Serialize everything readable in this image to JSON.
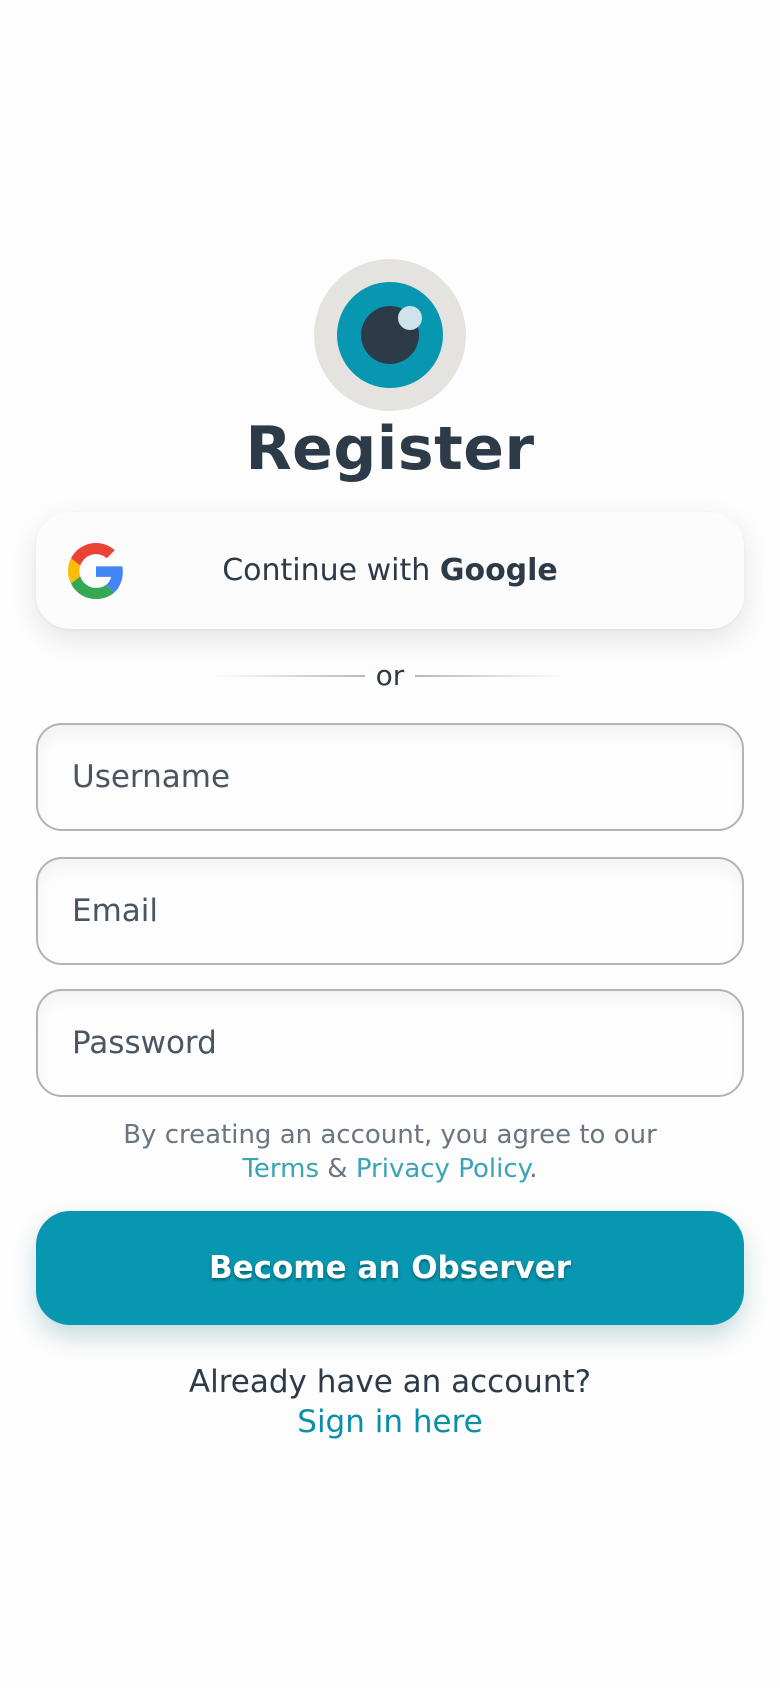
{
  "logo": {
    "icon": "eye-icon",
    "colors": {
      "outer": "#e4e3df",
      "iris": "#0897b1",
      "pupil": "#2d3a47"
    }
  },
  "title": "Register",
  "google_button": {
    "prefix": "Continue with ",
    "brand": "Google",
    "icon": "google-icon"
  },
  "divider_text": "or",
  "fields": {
    "username": {
      "placeholder": "Username",
      "value": ""
    },
    "email": {
      "placeholder": "Email",
      "value": ""
    },
    "password": {
      "placeholder": "Password",
      "value": ""
    }
  },
  "terms": {
    "line1": "By creating an account, you agree to our",
    "terms_link": "Terms",
    "amp": " & ",
    "privacy_link": "Privacy Policy",
    "period": "."
  },
  "cta_label": "Become an Observer",
  "signin": {
    "prompt": "Already have an account?",
    "link": "Sign in here"
  },
  "colors": {
    "accent": "#0897b1",
    "text": "#2d3a47",
    "link": "#3aa3b8"
  }
}
